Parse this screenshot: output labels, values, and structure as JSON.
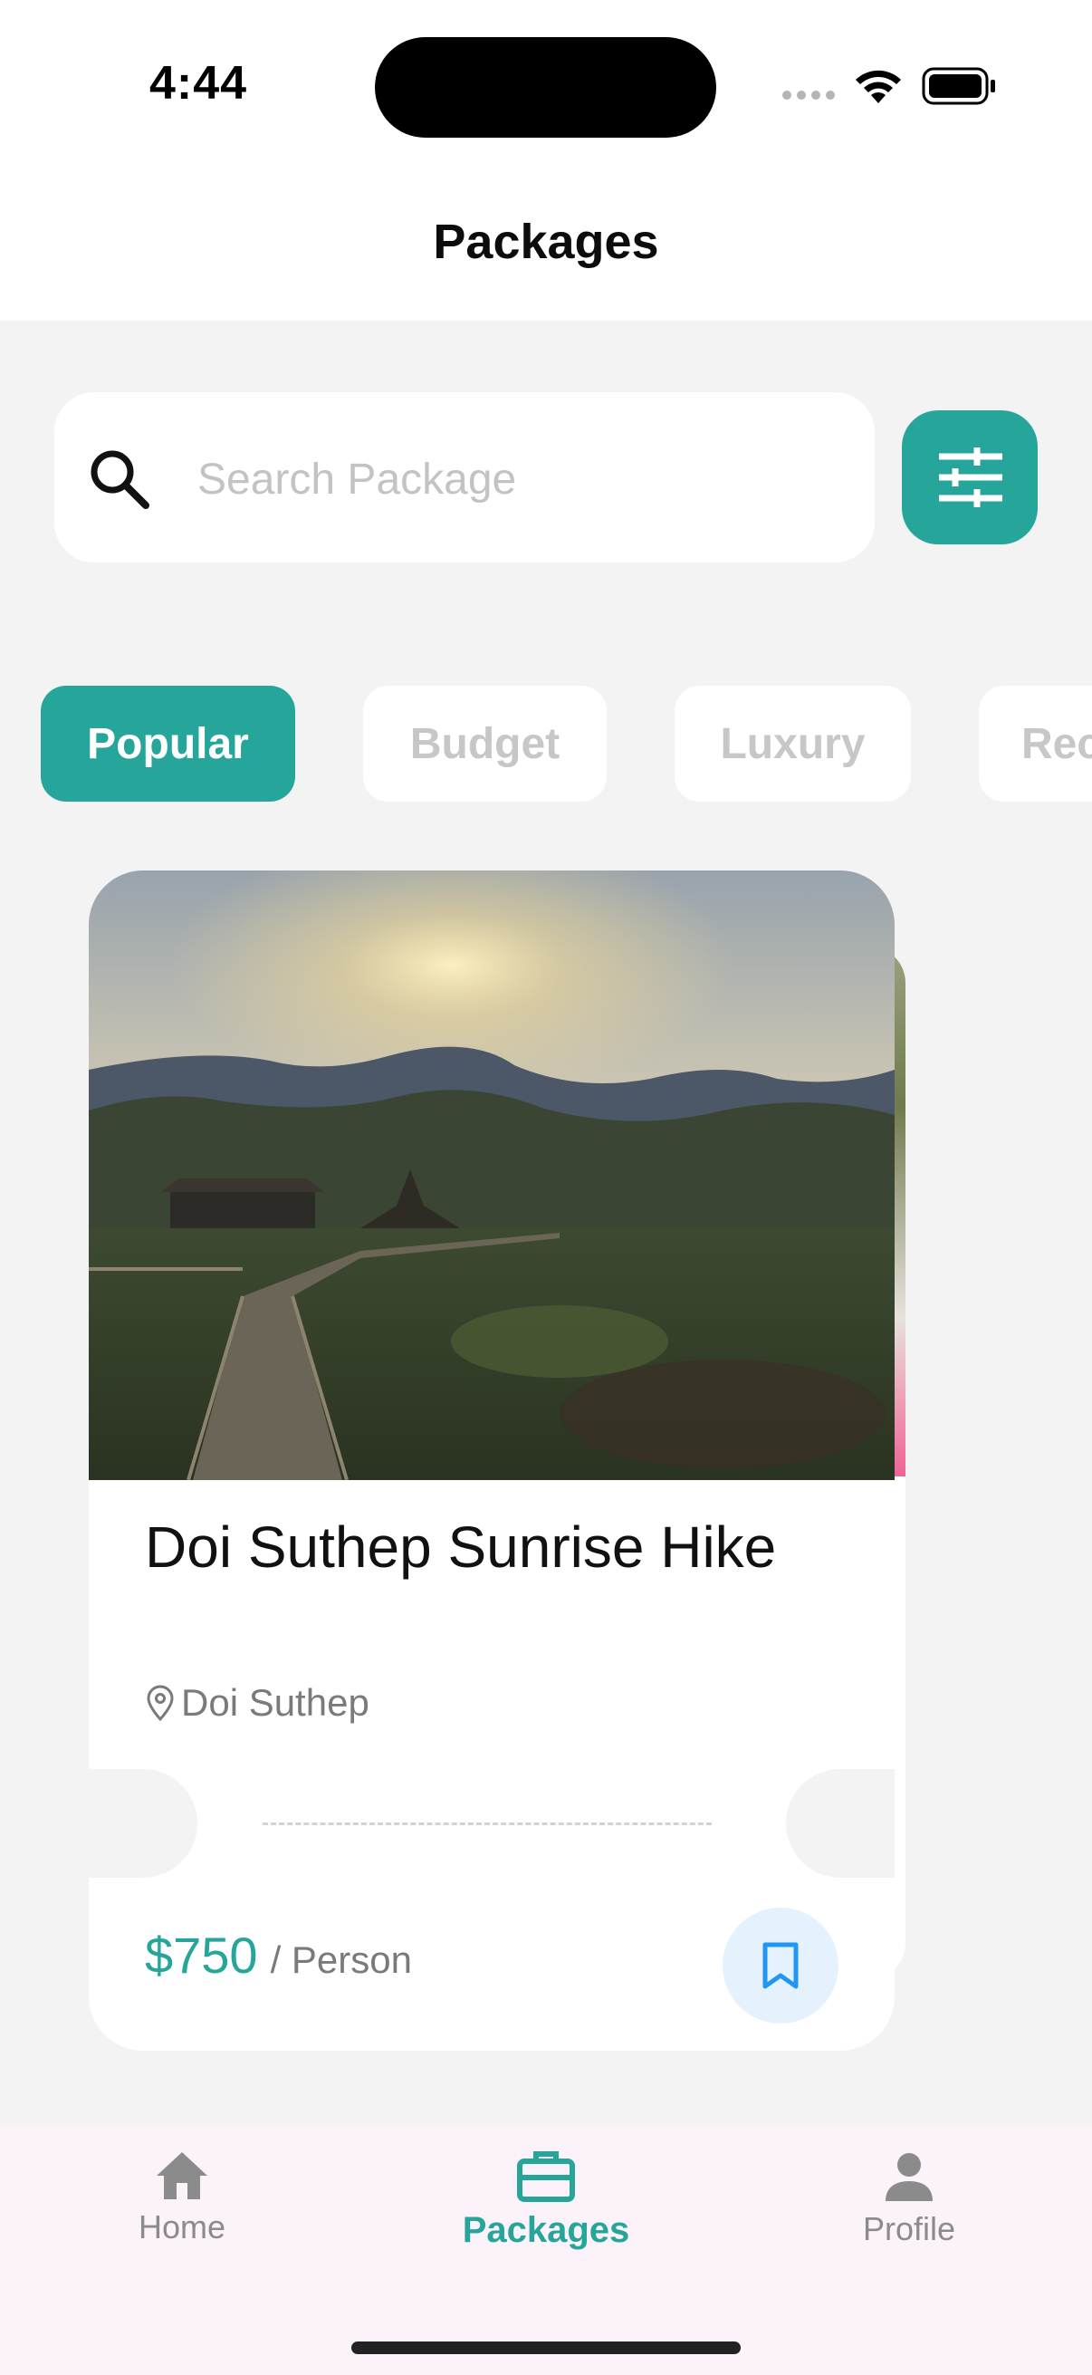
{
  "status_bar": {
    "time": "4:44"
  },
  "header": {
    "title": "Packages"
  },
  "search": {
    "placeholder": "Search Package",
    "value": ""
  },
  "chips": [
    {
      "label": "Popular",
      "active": true
    },
    {
      "label": "Budget",
      "active": false
    },
    {
      "label": "Luxury",
      "active": false
    },
    {
      "label": "Rec",
      "active": false
    }
  ],
  "card": {
    "title": "Doi Suthep Sunrise Hike",
    "location": "Doi Suthep",
    "price": "$750",
    "price_unit": "/ Person"
  },
  "bottom_nav": {
    "items": [
      {
        "label": "Home",
        "icon": "home-icon",
        "active": false
      },
      {
        "label": "Packages",
        "icon": "briefcase-icon",
        "active": true
      },
      {
        "label": "Profile",
        "icon": "person-icon",
        "active": false
      }
    ]
  },
  "colors": {
    "accent": "#26a69a",
    "background": "#f3f3f3",
    "nav_background": "#fcf2fa",
    "bookmark_bg": "#e5f2fd",
    "bookmark_icon": "#2196f3"
  }
}
